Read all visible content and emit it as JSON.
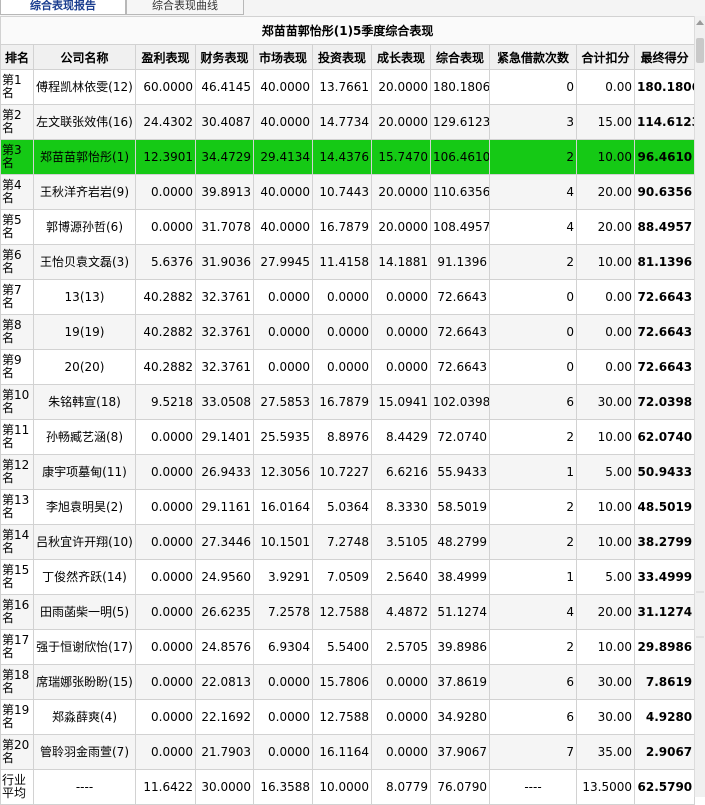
{
  "tabs": [
    {
      "label": "综合表现报告",
      "active": true
    },
    {
      "label": "综合表现曲线",
      "active": false
    }
  ],
  "report_title": "郑苗苗郭怡彤(1)5季度综合表现",
  "columns": [
    "排名",
    "公司名称",
    "盈利表现",
    "财务表现",
    "市场表现",
    "投资表现",
    "成长表现",
    "综合表现",
    "紧急借款次数",
    "合计扣分",
    "最终得分"
  ],
  "rows": [
    [
      "第1名",
      "傅程凯林依雯(12)",
      "60.0000",
      "46.4145",
      "40.0000",
      "13.7661",
      "20.0000",
      "180.1806",
      "0",
      "0.00",
      "180.1806"
    ],
    [
      "第2名",
      "左文联张效伟(16)",
      "24.4302",
      "30.4087",
      "40.0000",
      "14.7734",
      "20.0000",
      "129.6123",
      "3",
      "15.00",
      "114.6123"
    ],
    [
      "第3名",
      "郑苗苗郭怡彤(1)",
      "12.3901",
      "34.4729",
      "29.4134",
      "14.4376",
      "15.7470",
      "106.4610",
      "2",
      "10.00",
      "96.4610"
    ],
    [
      "第4名",
      "王秋洋齐岩岩(9)",
      "0.0000",
      "39.8913",
      "40.0000",
      "10.7443",
      "20.0000",
      "110.6356",
      "4",
      "20.00",
      "90.6356"
    ],
    [
      "第5名",
      "郭博源孙哲(6)",
      "0.0000",
      "31.7078",
      "40.0000",
      "16.7879",
      "20.0000",
      "108.4957",
      "4",
      "20.00",
      "88.4957"
    ],
    [
      "第6名",
      "王怡贝袁文磊(3)",
      "5.6376",
      "31.9036",
      "27.9945",
      "11.4158",
      "14.1881",
      "91.1396",
      "2",
      "10.00",
      "81.1396"
    ],
    [
      "第7名",
      "13(13)",
      "40.2882",
      "32.3761",
      "0.0000",
      "0.0000",
      "0.0000",
      "72.6643",
      "0",
      "0.00",
      "72.6643"
    ],
    [
      "第8名",
      "19(19)",
      "40.2882",
      "32.3761",
      "0.0000",
      "0.0000",
      "0.0000",
      "72.6643",
      "0",
      "0.00",
      "72.6643"
    ],
    [
      "第9名",
      "20(20)",
      "40.2882",
      "32.3761",
      "0.0000",
      "0.0000",
      "0.0000",
      "72.6643",
      "0",
      "0.00",
      "72.6643"
    ],
    [
      "第10名",
      "朱铭韩宣(18)",
      "9.5218",
      "33.0508",
      "27.5853",
      "16.7879",
      "15.0941",
      "102.0398",
      "6",
      "30.00",
      "72.0398"
    ],
    [
      "第11名",
      "孙畅臧艺涵(8)",
      "0.0000",
      "29.1401",
      "25.5935",
      "8.8976",
      "8.4429",
      "72.0740",
      "2",
      "10.00",
      "62.0740"
    ],
    [
      "第12名",
      "康宇项墓甸(11)",
      "0.0000",
      "26.9433",
      "12.3056",
      "10.7227",
      "6.6216",
      "55.9433",
      "1",
      "5.00",
      "50.9433"
    ],
    [
      "第13名",
      "李旭袁明昊(2)",
      "0.0000",
      "29.1161",
      "16.0164",
      "5.0364",
      "8.3330",
      "58.5019",
      "2",
      "10.00",
      "48.5019"
    ],
    [
      "第14名",
      "吕秋宜许开翔(10)",
      "0.0000",
      "27.3446",
      "10.1501",
      "7.2748",
      "3.5105",
      "48.2799",
      "2",
      "10.00",
      "38.2799"
    ],
    [
      "第15名",
      "丁俊然齐跃(14)",
      "0.0000",
      "24.9560",
      "3.9291",
      "7.0509",
      "2.5640",
      "38.4999",
      "1",
      "5.00",
      "33.4999"
    ],
    [
      "第16名",
      "田雨菡柴一明(5)",
      "0.0000",
      "26.6235",
      "7.2578",
      "12.7588",
      "4.4872",
      "51.1274",
      "4",
      "20.00",
      "31.1274"
    ],
    [
      "第17名",
      "强于恒谢欣怡(17)",
      "0.0000",
      "24.8576",
      "6.9304",
      "5.5400",
      "2.5705",
      "39.8986",
      "2",
      "10.00",
      "29.8986"
    ],
    [
      "第18名",
      "席瑞娜张盼盼(15)",
      "0.0000",
      "22.0813",
      "0.0000",
      "15.7806",
      "0.0000",
      "37.8619",
      "6",
      "30.00",
      "7.8619"
    ],
    [
      "第19名",
      "郑淼薛爽(4)",
      "0.0000",
      "22.1692",
      "0.0000",
      "12.7588",
      "0.0000",
      "34.9280",
      "6",
      "30.00",
      "4.9280"
    ],
    [
      "第20名",
      "管聆羽金雨萱(7)",
      "0.0000",
      "21.7903",
      "0.0000",
      "16.1164",
      "0.0000",
      "37.9067",
      "7",
      "35.00",
      "2.9067"
    ]
  ],
  "average_row": [
    "行业平均",
    "----",
    "11.6422",
    "30.0000",
    "16.3588",
    "10.0000",
    "8.0779",
    "76.0790",
    "----",
    "13.5000",
    "62.5790"
  ],
  "highlight_row_index": 2,
  "colors": {
    "highlight": "#15c915",
    "active_tab_text": "#1a3d8f"
  }
}
